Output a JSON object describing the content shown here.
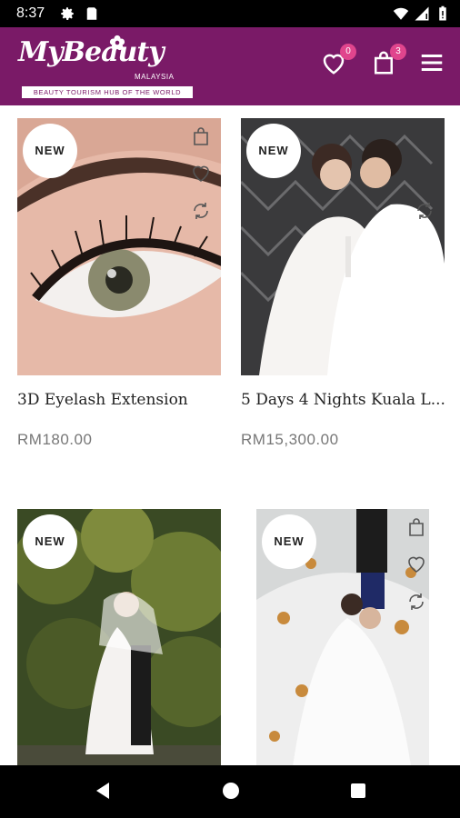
{
  "status_bar": {
    "time": "8:37"
  },
  "header": {
    "logo_text": "MyBeauty",
    "logo_country": "MALAYSIA",
    "logo_tagline": "BEAUTY TOURISM HUB OF THE WORLD",
    "wishlist_count": "0",
    "cart_count": "3"
  },
  "products": [
    {
      "badge": "NEW",
      "title": "3D Eyelash Extension",
      "price": "RM180.00"
    },
    {
      "badge": "NEW",
      "title": "5 Days 4 Nights Kuala L...",
      "price": "RM15,300.00"
    },
    {
      "badge": "NEW",
      "title": "",
      "price": ""
    },
    {
      "badge": "NEW",
      "title": "",
      "price": ""
    }
  ],
  "colors": {
    "brand": "#7a1a67",
    "badge": "#e0458d"
  }
}
